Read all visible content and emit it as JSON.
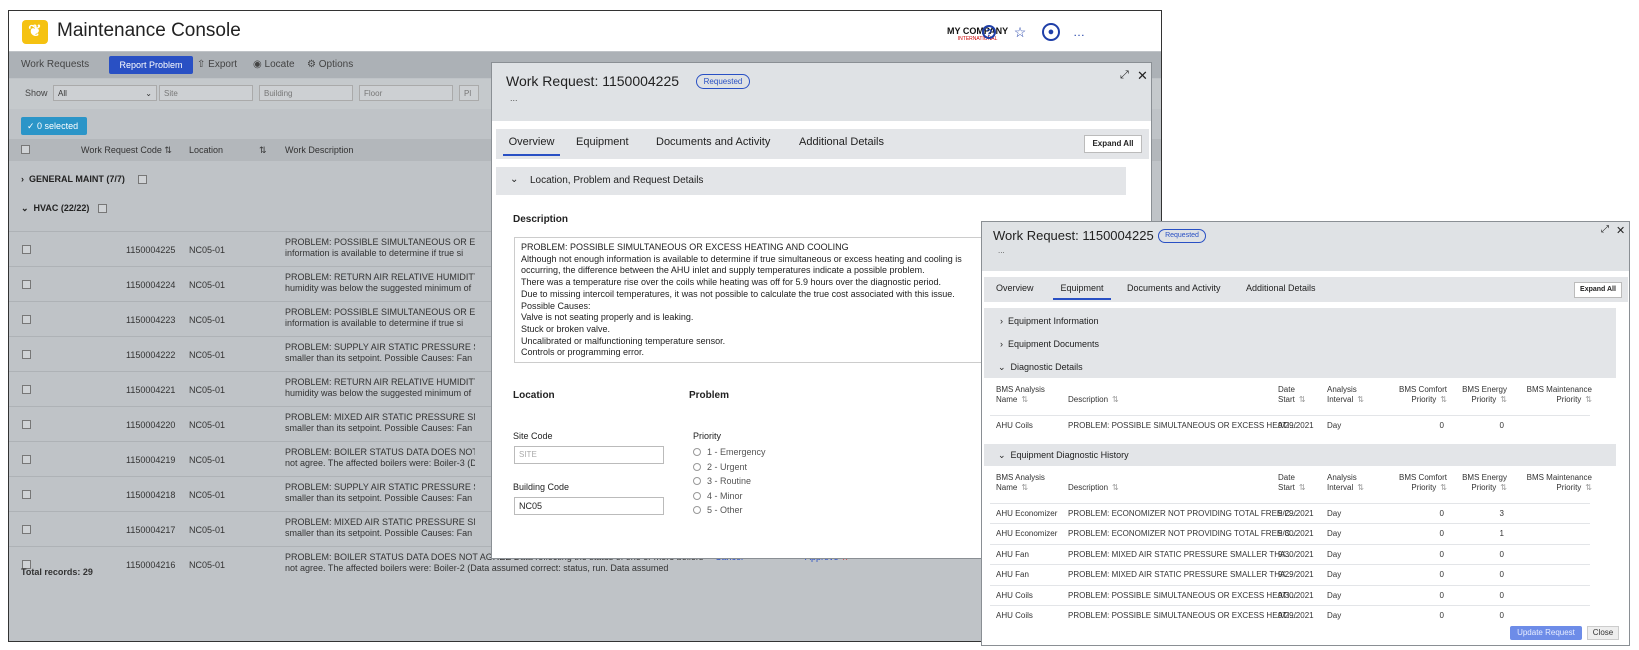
{
  "app": {
    "title": "Maintenance Console",
    "company": "MY COMPANY",
    "company_sub": "INTERNATIONAL"
  },
  "toolbar": {
    "work_requests": "Work Requests",
    "report_problem": "Report Problem",
    "export": "Export",
    "locate": "Locate",
    "options": "Options"
  },
  "filters": {
    "show_label": "Show",
    "show_value": "All",
    "site_ph": "Site",
    "building_ph": "Building",
    "floor_ph": "Floor"
  },
  "selection": "0 selected",
  "columns": {
    "code": "Work Request Code",
    "location": "Location",
    "description": "Work Description"
  },
  "groups": [
    {
      "label": "GENERAL MAINT (7/7)"
    },
    {
      "label": "HVAC (22/22)"
    }
  ],
  "rows": [
    {
      "code": "1150004225",
      "loc": "NC05-01",
      "d1": "PROBLEM: POSSIBLE SIMULTANEOUS OR EXCES",
      "d2": "information is available to determine if true si"
    },
    {
      "code": "1150004224",
      "loc": "NC05-01",
      "d1": "PROBLEM: RETURN AIR RELATIVE HUMIDITY BE",
      "d2": "humidity was below the suggested minimum of"
    },
    {
      "code": "1150004223",
      "loc": "NC05-01",
      "d1": "PROBLEM: POSSIBLE SIMULTANEOUS OR EXCES",
      "d2": "information is available to determine if true si"
    },
    {
      "code": "1150004222",
      "loc": "NC05-01",
      "d1": "PROBLEM: SUPPLY AIR STATIC PRESSURE SMALL",
      "d2": "smaller than its setpoint. Possible Causes: Fan"
    },
    {
      "code": "1150004221",
      "loc": "NC05-01",
      "d1": "PROBLEM: RETURN AIR RELATIVE HUMIDITY BE",
      "d2": "humidity was below the suggested minimum of"
    },
    {
      "code": "1150004220",
      "loc": "NC05-01",
      "d1": "PROBLEM: MIXED AIR STATIC PRESSURE SMALL",
      "d2": "smaller than its setpoint. Possible Causes: Fan"
    },
    {
      "code": "1150004219",
      "loc": "NC05-01",
      "d1": "PROBLEM: BOILER STATUS DATA DOES NOT AG",
      "d2": "not agree. The affected boilers were: Boiler-3 (D"
    },
    {
      "code": "1150004218",
      "loc": "NC05-01",
      "d1": "PROBLEM: SUPPLY AIR STATIC PRESSURE SMAL",
      "d2": "smaller than its setpoint. Possible Causes: Fan"
    },
    {
      "code": "1150004217",
      "loc": "NC05-01",
      "d1": "PROBLEM: MIXED AIR STATIC PRESSURE SMALL",
      "d2": "smaller than its setpoint. Possible Causes: Fan"
    },
    {
      "code": "1150004216",
      "loc": "NC05-01",
      "d1": "PROBLEM: BOILER STATUS DATA DOES NOT AGREE Data reflecting the status of one or more boilers did",
      "d2": "not agree. The affected boilers were: Boiler-2 (Data assumed correct: status, run. Data assumed"
    }
  ],
  "row_actions": {
    "cancel": "Cancel",
    "approve": "Approve"
  },
  "total": "Total records: 29",
  "dialog1": {
    "title": "Work Request: 1150004225",
    "status": "Requested",
    "ellipsis": "...",
    "tabs": [
      "Overview",
      "Equipment",
      "Documents and Activity",
      "Additional Details"
    ],
    "expand_all": "Expand All",
    "section": "Location, Problem and Request Details",
    "description_label": "Description",
    "description_lines": [
      "PROBLEM: POSSIBLE SIMULTANEOUS OR EXCESS HEATING AND COOLING",
      "Although not enough information is available to determine if true simultaneous or excess heating and cooling is",
      "occurring, the difference between the AHU inlet and supply temperatures indicate a possible problem.",
      "There was a temperature rise over the coils while heating was off for 5.9 hours over the diagnostic period.",
      "Due to missing intercoil temperatures, it was not possible to calculate the true cost associated with this issue.",
      "Possible Causes:",
      "Valve is not seating properly and is leaking.",
      "Stuck or broken valve.",
      "Uncalibrated or malfunctioning temperature sensor.",
      "Controls or programming error."
    ],
    "location_label": "Location",
    "problem_label": "Problem",
    "site_code_label": "Site Code",
    "site_ph": "SITE",
    "building_code_label": "Building Code",
    "building_value": "NC05",
    "priority_label": "Priority",
    "priorities": [
      "1 - Emergency",
      "2 - Urgent",
      "3 - Routine",
      "4 - Minor",
      "5 - Other"
    ]
  },
  "dialog2": {
    "title": "Work Request: 1150004225",
    "status": "Requested",
    "ellipsis": "...",
    "tabs": [
      "Overview",
      "Equipment",
      "Documents and Activity",
      "Additional Details"
    ],
    "expand_all": "Expand All",
    "sections": {
      "info": "Equipment Information",
      "docs": "Equipment Documents",
      "diag": "Diagnostic Details",
      "history": "Equipment Diagnostic History"
    },
    "cols": {
      "name1": "BMS Analysis",
      "name2": "Name",
      "desc": "Description",
      "date1": "Date",
      "date2": "Start",
      "int1": "Analysis",
      "int2": "Interval",
      "comfort1": "BMS Comfort",
      "comfort2": "Priority",
      "energy1": "BMS Energy",
      "energy2": "Priority",
      "maint1": "BMS Maintenance",
      "maint2": "Priority"
    },
    "details": [
      {
        "name": "AHU Coils",
        "desc": "PROBLEM: POSSIBLE SIMULTANEOUS OR EXCESS HEATI...",
        "date": "9/29/2021",
        "interval": "Day",
        "comfort": "0",
        "energy": "0"
      }
    ],
    "history": [
      {
        "name": "AHU Economizer",
        "desc": "PROBLEM: ECONOMIZER NOT PROVIDING TOTAL FREE C...",
        "date": "9/29/2021",
        "interval": "Day",
        "comfort": "0",
        "energy": "3"
      },
      {
        "name": "AHU Economizer",
        "desc": "PROBLEM: ECONOMIZER NOT PROVIDING TOTAL FREE C...",
        "date": "9/30/2021",
        "interval": "Day",
        "comfort": "0",
        "energy": "1"
      },
      {
        "name": "AHU Fan",
        "desc": "PROBLEM: MIXED AIR STATIC PRESSURE SMALLER THA...",
        "date": "9/30/2021",
        "interval": "Day",
        "comfort": "0",
        "energy": "0"
      },
      {
        "name": "AHU Fan",
        "desc": "PROBLEM: MIXED AIR STATIC PRESSURE SMALLER THA...",
        "date": "9/29/2021",
        "interval": "Day",
        "comfort": "0",
        "energy": "0"
      },
      {
        "name": "AHU Coils",
        "desc": "PROBLEM: POSSIBLE SIMULTANEOUS OR EXCESS HEATI...",
        "date": "9/30/2021",
        "interval": "Day",
        "comfort": "0",
        "energy": "0"
      },
      {
        "name": "AHU Coils",
        "desc": "PROBLEM: POSSIBLE SIMULTANEOUS OR EXCESS HEATI...",
        "date": "9/29/2021",
        "interval": "Day",
        "comfort": "0",
        "energy": "0"
      }
    ],
    "update_request": "Update Request",
    "close": "Close"
  },
  "colors": {
    "accent": "#2950c4",
    "selected_badge": "#2b95c8",
    "logo": "#f5c211",
    "approve_star": "#d00000"
  },
  "icons": [
    "logo-icon",
    "help-icon",
    "favorites-icon",
    "user-icon",
    "more-icon",
    "export-icon",
    "locate-icon",
    "options-icon",
    "check-icon",
    "chevron-right-icon",
    "chevron-down-icon",
    "expand-icon",
    "close-icon",
    "sort-icon",
    "star-icon"
  ]
}
